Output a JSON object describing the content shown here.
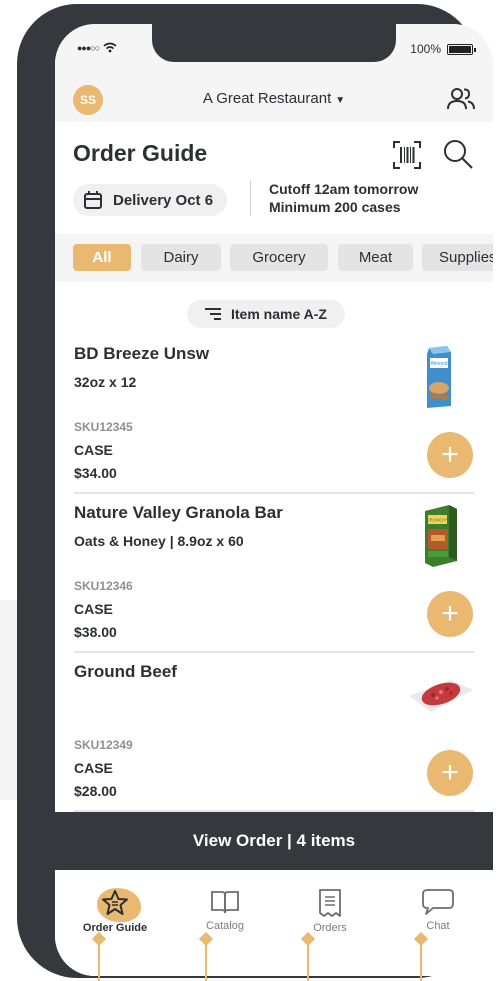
{
  "status_bar": {
    "signal": "●●●○○",
    "battery_label": "100%",
    "battery_level": 1.0
  },
  "header": {
    "avatar_initials": "SS",
    "restaurant_name": "A Great Restaurant"
  },
  "page": {
    "title": "Order Guide",
    "delivery_label": "Delivery Oct 6",
    "cutoff_line1": "Cutoff 12am tomorrow",
    "cutoff_line2": "Minimum 200 cases"
  },
  "filters": [
    {
      "label": "All",
      "active": true
    },
    {
      "label": "Dairy",
      "active": false
    },
    {
      "label": "Grocery",
      "active": false
    },
    {
      "label": "Meat",
      "active": false
    },
    {
      "label": "Supplies",
      "active": false
    }
  ],
  "sort_label": "Item name A-Z",
  "items": [
    {
      "name": "BD Breeze Unsw",
      "pack": "32oz x 12",
      "sku": "SKU12345",
      "unit": "CASE",
      "price": "$34.00",
      "image": "almond-milk-carton"
    },
    {
      "name": "Nature Valley Granola Bar",
      "pack": "Oats & Honey | 8.9oz x 60",
      "sku": "SKU12346",
      "unit": "CASE",
      "price": "$38.00",
      "image": "granola-box"
    },
    {
      "name": "Ground Beef",
      "pack": "",
      "sku": "SKU12349",
      "unit": "CASE",
      "price": "$28.00",
      "image": "ground-beef-tray"
    }
  ],
  "view_order_label": "View Order | 4 items",
  "tabs": [
    {
      "label": "Order Guide",
      "icon": "star-icon",
      "active": true
    },
    {
      "label": "Catalog",
      "icon": "book-icon",
      "active": false
    },
    {
      "label": "Orders",
      "icon": "receipt-icon",
      "active": false
    },
    {
      "label": "Chat",
      "icon": "chat-bubble-icon",
      "active": false
    }
  ],
  "colors": {
    "accent": "#e9b971",
    "dark": "#35383d",
    "chip": "#e4e4e5",
    "text": "#2d2f33"
  }
}
